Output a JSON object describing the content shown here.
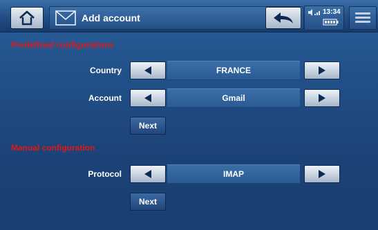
{
  "header": {
    "title": "Add account",
    "home_icon": "home-icon",
    "mail_icon": "envelope-icon",
    "back_icon": "back-arrow-icon",
    "menu_icon": "menu-icon"
  },
  "status": {
    "time": "13:34",
    "volume_icon": "volume-icon",
    "battery_icon": "battery-icon"
  },
  "sections": {
    "predefined_title": "Predefined configurations",
    "manual_title": "Manual configuration"
  },
  "rows": {
    "country": {
      "label": "Country",
      "value": "FRANCE"
    },
    "account": {
      "label": "Account",
      "value": "Gmail"
    },
    "protocol": {
      "label": "Protocol",
      "value": "IMAP"
    }
  },
  "buttons": {
    "next_predefined": "Next",
    "next_manual": "Next"
  },
  "colors": {
    "section_title": "#e01818",
    "background": "#214f87"
  }
}
